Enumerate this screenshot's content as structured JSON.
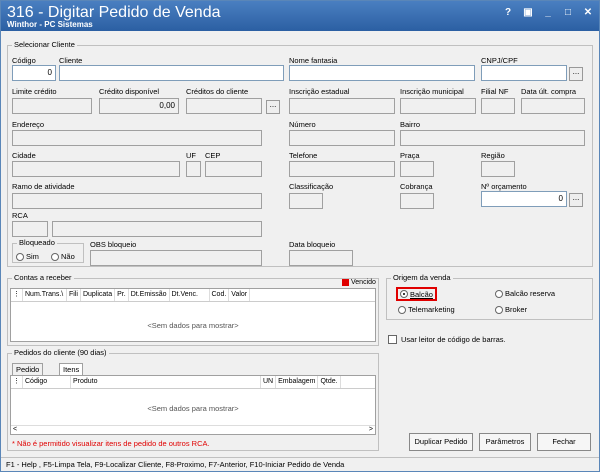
{
  "window": {
    "title": "316 - Digitar Pedido de Venda",
    "subtitle": "Winthor - PC Sistemas",
    "controls": [
      "?",
      "▣",
      "_",
      "□",
      "✕"
    ]
  },
  "cliente": {
    "group_title": "Selecionar Cliente",
    "codigo_label": "Código",
    "codigo_value": "0",
    "cliente_label": "Cliente",
    "nome_fantasia_label": "Nome fantasia",
    "cnpj_label": "CNPJ/CPF",
    "limite_credito_label": "Limite crédito",
    "credito_disponivel_label": "Crédito disponível",
    "credito_disponivel_value": "0,00",
    "creditos_cliente_label": "Créditos do cliente",
    "inscricao_estadual_label": "Inscrição estadual",
    "inscricao_municipal_label": "Inscrição municipal",
    "filial_nf_label": "Filial NF",
    "data_ult_compra_label": "Data últ. compra",
    "endereco_label": "Endereço",
    "numero_label": "Número",
    "bairro_label": "Bairro",
    "cidade_label": "Cidade",
    "uf_label": "UF",
    "cep_label": "CEP",
    "telefone_label": "Telefone",
    "praca_label": "Praça",
    "regiao_label": "Região",
    "ramo_label": "Ramo de atividade",
    "classificacao_label": "Classificação",
    "cobranca_label": "Cobrança",
    "orcamento_label": "Nº orçamento",
    "orcamento_value": "0",
    "rca_label": "RCA",
    "bloqueado_label": "Bloqueado",
    "sim_label": "Sim",
    "nao_label": "Não",
    "obs_bloqueio_label": "OBS bloqueio",
    "data_bloqueio_label": "Data bloqueio",
    "dots_label": "..."
  },
  "contas": {
    "group_title": "Contas a receber",
    "vencido_label": "Vencido",
    "vencido_color": "#e00000",
    "columns": [
      "Num.Trans.\\",
      "Fili",
      "Duplicata",
      "Pr.",
      "Dt.Emissão",
      "Dt.Venc.",
      "Cod.",
      "Valor"
    ],
    "empty_text": "<Sem dados para mostrar>"
  },
  "origem": {
    "group_title": "Origem da venda",
    "options": [
      "Balcão",
      "Balcão reserva",
      "Telemarketing",
      "Broker"
    ],
    "selected": "Balcão",
    "highlight_color": "#e00000"
  },
  "leitor": {
    "label": "Usar leitor de código de barras."
  },
  "pedidos": {
    "group_title": "Pedidos do cliente (90 dias)",
    "tabs": [
      "Pedido",
      "Itens"
    ],
    "active_tab": "Itens",
    "columns": [
      "Código",
      "Produto",
      "UN",
      "Embalagem",
      "Qtde."
    ],
    "empty_text": "<Sem dados para mostrar>",
    "warning": "* Não é permitido visualizar itens de pedido de outros RCA.",
    "warning_color": "#e00000"
  },
  "buttons": {
    "duplicar": "Duplicar Pedido",
    "parametros": "Parâmetros",
    "fechar": "Fechar"
  },
  "statusbar": {
    "text": "F1 - Help , F5-Limpa Tela, F9-Localizar Cliente, F8-Proximo, F7-Anterior, F10-Iniciar Pedido de Venda"
  }
}
